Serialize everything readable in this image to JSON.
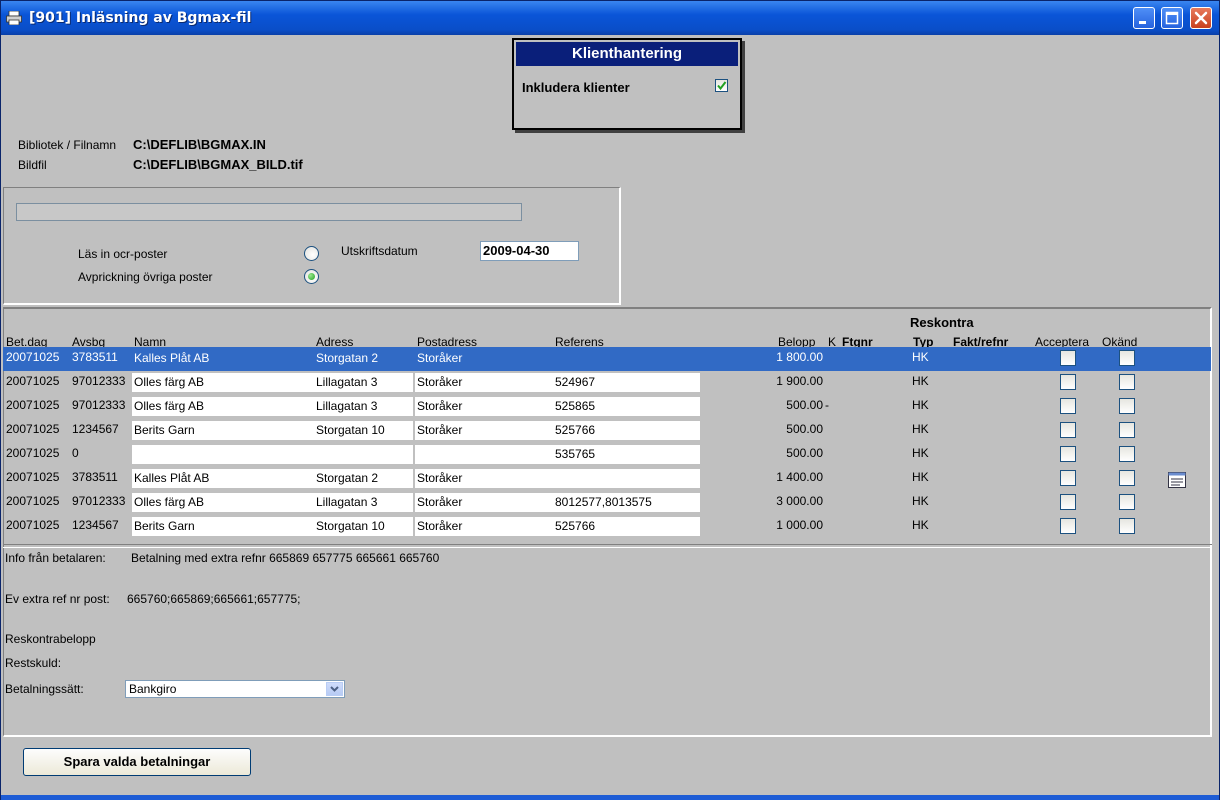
{
  "window": {
    "title": "[901]  Inläsning av Bgmax-fil"
  },
  "popup": {
    "title": "Klienthantering",
    "include_label": "Inkludera klienter",
    "include_checked": true
  },
  "file": {
    "library_label": "Bibliotek / Filnamn",
    "library_value": "C:\\DEFLIB\\BGMAX.IN",
    "image_label": "Bildfil",
    "image_value": "C:\\DEFLIB\\BGMAX_BILD.tif"
  },
  "options": {
    "ocr_label": "Läs in ocr-poster",
    "other_label": "Avprickning övriga poster",
    "selected": "other",
    "print_date_label": "Utskriftsdatum",
    "print_date_value": "2009-04-30"
  },
  "table": {
    "group_header": "Reskontra",
    "headers": {
      "betdag": "Bet.dag",
      "avsbg": "Avsbg",
      "namn": "Namn",
      "adress": "Adress",
      "postadress": "Postadress",
      "referens": "Referens",
      "belopp": "Belopp",
      "k": "K",
      "ftgnr": "Ftgnr",
      "typ": "Typ",
      "faktrefnr": "Fakt/refnr",
      "acceptera": "Acceptera",
      "okand": "Okänd"
    },
    "rows": [
      {
        "betdag": "20071025",
        "avsbg": "3783511",
        "namn": "Kalles Plåt AB",
        "adress": "Storgatan 2",
        "postadress": "Storåker",
        "referens": "",
        "belopp": "1 800.00",
        "k": "",
        "typ": "HK"
      },
      {
        "betdag": "20071025",
        "avsbg": "97012333",
        "namn": "Olles färg AB",
        "adress": "Lillagatan 3",
        "postadress": "Storåker",
        "referens": "524967",
        "belopp": "1 900.00",
        "k": "",
        "typ": "HK"
      },
      {
        "betdag": "20071025",
        "avsbg": "97012333",
        "namn": "Olles färg AB",
        "adress": "Lillagatan 3",
        "postadress": "Storåker",
        "referens": "525865",
        "belopp": "500.00",
        "k": "-",
        "typ": "HK"
      },
      {
        "betdag": "20071025",
        "avsbg": "1234567",
        "namn": "Berits Garn",
        "adress": "Storgatan 10",
        "postadress": "Storåker",
        "referens": "525766",
        "belopp": "500.00",
        "k": "",
        "typ": "HK"
      },
      {
        "betdag": "20071025",
        "avsbg": "0",
        "namn": "",
        "adress": "",
        "postadress": "",
        "referens": "535765",
        "belopp": "500.00",
        "k": "",
        "typ": "HK"
      },
      {
        "betdag": "20071025",
        "avsbg": "3783511",
        "namn": "Kalles Plåt AB",
        "adress": "Storgatan 2",
        "postadress": "Storåker",
        "referens": "",
        "belopp": "1 400.00",
        "k": "",
        "typ": "HK"
      },
      {
        "betdag": "20071025",
        "avsbg": "97012333",
        "namn": "Olles färg AB",
        "adress": "Lillagatan 3",
        "postadress": "Storåker",
        "referens": "8012577,8013575",
        "belopp": "3 000.00",
        "k": "",
        "typ": "HK"
      },
      {
        "betdag": "20071025",
        "avsbg": "1234567",
        "namn": "Berits Garn",
        "adress": "Storgatan 10",
        "postadress": "Storåker",
        "referens": "525766",
        "belopp": "1 000.00",
        "k": "",
        "typ": "HK"
      }
    ]
  },
  "info": {
    "payer_label": "Info från betalaren:",
    "payer_value": "Betalning med extra refnr 665869 657775 665661 665760",
    "extra_label": "Ev extra ref nr post:",
    "extra_value": "665760;665869;665661;657775;",
    "reskontra_label": "Reskontrabelopp",
    "restskuld_label": "Restskuld:",
    "payment_method_label": "Betalningssätt:",
    "payment_method_value": "Bankgiro"
  },
  "buttons": {
    "save": "Spara valda betalningar"
  }
}
